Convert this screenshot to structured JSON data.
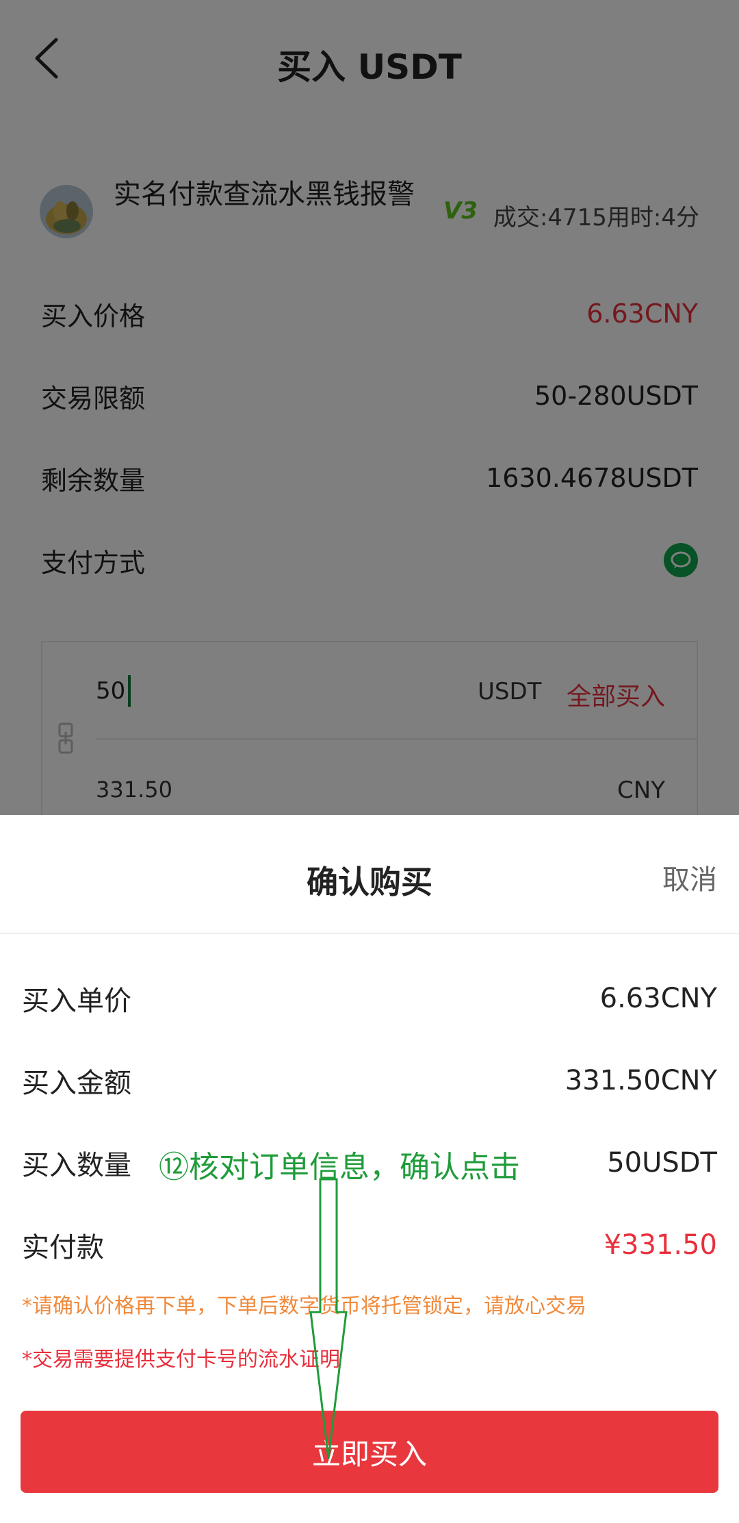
{
  "nav": {
    "title": "买入 USDT"
  },
  "seller": {
    "name": "实名付款查流水黑钱报警",
    "level": "V3",
    "stats": "成交:4715用时:4分"
  },
  "info": [
    {
      "label": "买入价格",
      "value": "6.63CNY",
      "highlight": true
    },
    {
      "label": "交易限额",
      "value": "50-280USDT",
      "highlight": false
    },
    {
      "label": "剩余数量",
      "value": "1630.4678USDT",
      "highlight": false
    },
    {
      "label": "支付方式",
      "value": "",
      "icon": "wechat-pay-icon"
    }
  ],
  "amount": {
    "usdt_value": "50",
    "usdt_unit": "USDT",
    "buy_all_label": "全部买入",
    "cny_value": "331.50",
    "cny_unit": "CNY"
  },
  "sheet": {
    "title": "确认购买",
    "cancel_label": "取消",
    "rows": [
      {
        "label": "买入单价",
        "value": "6.63CNY"
      },
      {
        "label": "买入金额",
        "value": "331.50CNY"
      },
      {
        "label": "买入数量",
        "value": "50USDT"
      },
      {
        "label": "实付款",
        "value": "¥331.50"
      }
    ],
    "note_1": "*请确认价格再下单，下单后数字货币将托管锁定，请放心交易",
    "note_2": "*交易需要提供支付卡号的流水证明",
    "buy_button_label": "立即买入"
  },
  "annotation": {
    "text": "⑫核对订单信息，确认点击"
  },
  "colors": {
    "accent_red": "#e8303c",
    "button_red": "#e8383e",
    "warning_orange": "#f08a3c",
    "annotation_green": "#1f9c3a",
    "wechat_green": "#0fa74f"
  }
}
